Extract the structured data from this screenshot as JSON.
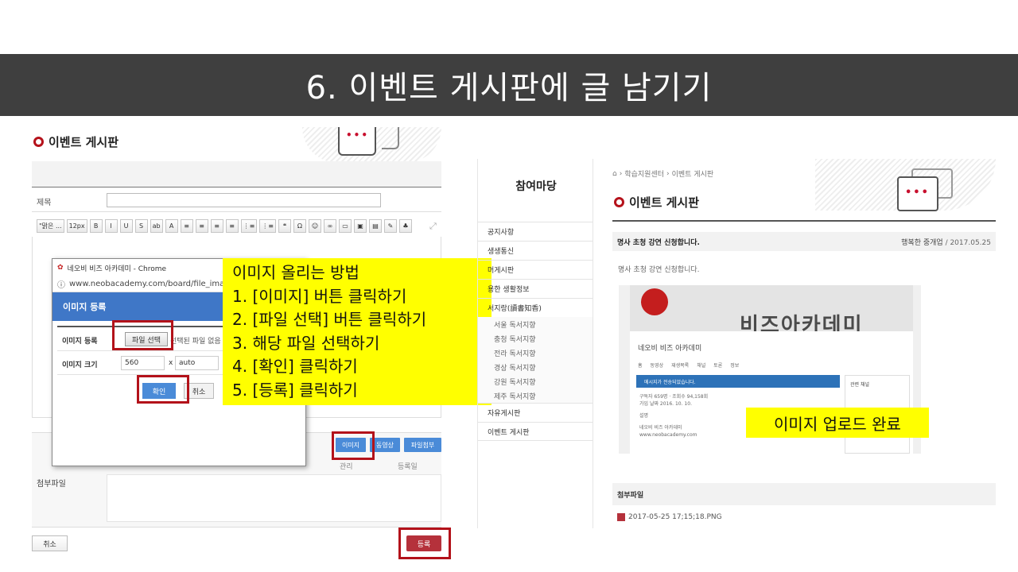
{
  "banner": {
    "title": "6. 이벤트 게시판에 글 남기기"
  },
  "left": {
    "board_title": "이벤트 게시판",
    "subject_label": "제목",
    "toolbar": [
      "\"맑은 ...",
      "12px",
      "B",
      "I",
      "U",
      "S",
      "ab",
      "A",
      "≡",
      "≡",
      "≡",
      "≡",
      "⋮≡",
      "⋮≡",
      "❝",
      "Ω",
      "☺",
      "∞",
      "▭",
      "▣",
      "▤",
      "✎",
      "♣"
    ],
    "attach_label": "첨부파일",
    "columns": {
      "manage": "관리",
      "date": "등록일"
    },
    "buttons": {
      "image": "이미지",
      "video": "동영상",
      "attach": "파일첨부",
      "cancel": "취소",
      "register": "등록"
    }
  },
  "popup": {
    "window_title": "네오비 비즈 아카데미 - Chrome",
    "url": "www.neobacademy.com/board/file_image.",
    "header": "이미지 등록",
    "image_register_label": "이미지 등록",
    "file_button": "파일 선택",
    "file_none": "선택된 파일 없음",
    "size_label": "이미지 크기",
    "width": "560",
    "times": "x",
    "height": "auto",
    "ok": "확인",
    "cancel": "취소"
  },
  "callout": {
    "title": "이미지 올리는 방법",
    "steps": [
      "1.  [이미지] 버튼 클릭하기",
      "2.  [파일 선택] 버튼 클릭하기",
      "3.  해당 파일 선택하기",
      "4.  [확인] 클릭하기",
      "5.  [등록] 클릭하기"
    ]
  },
  "side_nav": {
    "title": "참여마당",
    "items": [
      "공지사항",
      "생생통신",
      "머게시판",
      "용한 생활정보",
      "서지랑(讀書知香)"
    ],
    "sub_items": [
      "서울 독서지향",
      "충청 독서지향",
      "전라 독서지향",
      "경상 독서지향",
      "강원 독서지향",
      "제주 독서지향"
    ],
    "bottom_items": [
      "자유게시판",
      "이벤트 게시판"
    ]
  },
  "right": {
    "breadcrumb": [
      "학습지원센터",
      "이벤트 게시판"
    ],
    "board_title": "이벤트 게시판",
    "post_subject": "명사 초청 강연 신청합니다.",
    "post_author": "행복한 중개업",
    "post_date": "/ 2017.05.25",
    "post_body": "명사 초청 강연 신청합니다.",
    "shot": {
      "big_text": "비즈아카데미",
      "channel_name": "네오비 비즈 아카데미",
      "tabs": [
        "홈",
        "동영상",
        "재생목록",
        "채널",
        "토론",
        "정보"
      ],
      "alert": "메시지가 전송되었습니다.",
      "side": "관련 채널",
      "lines": [
        "구독자 659명 · 조회수 94,158회",
        "가입 날짜 2016. 10. 10.",
        "설명",
        "네오비 비즈 아카데미",
        "www.neobacademy.com"
      ]
    },
    "upload_done": "이미지 업로드 완료",
    "attach_label": "첨부파일",
    "attach_file": "2017-05-25 17;15;18.PNG"
  }
}
